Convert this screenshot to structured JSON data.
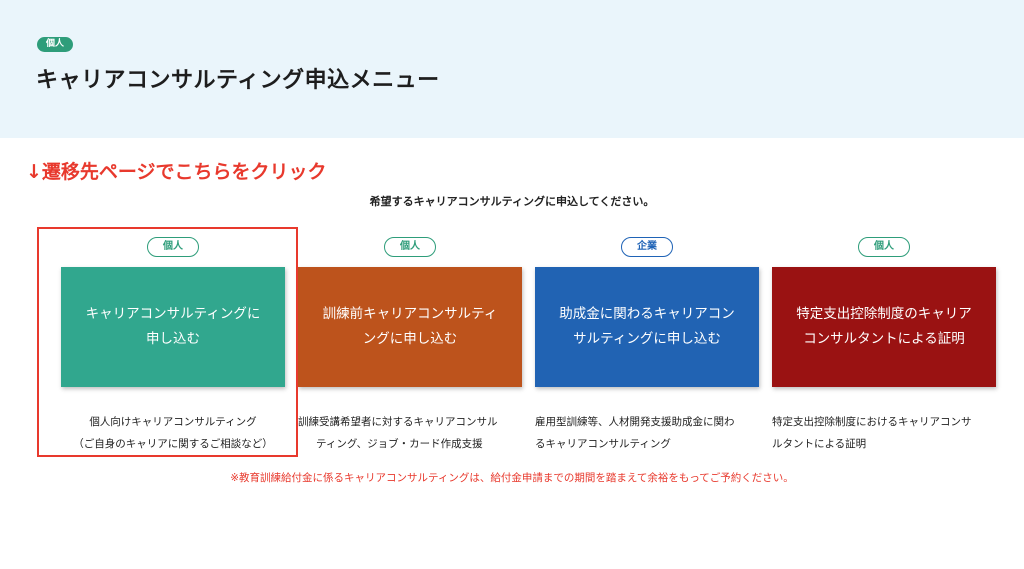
{
  "header": {
    "badge": "個人",
    "title": "キャリアコンサルティング申込メニュー"
  },
  "annotation": "↓遷移先ページでこちらをクリック",
  "instruction": "希望するキャリアコンサルティングに申込してください。",
  "cards": [
    {
      "badge": "個人",
      "tile_line1": "キャリアコンサルティングに",
      "tile_line2": "申し込む",
      "desc_line1": "個人向けキャリアコンサルティング",
      "desc_line2": "（ご自身のキャリアに関するご相談など）"
    },
    {
      "badge": "個人",
      "tile_line1": "訓練前キャリアコンサルティ",
      "tile_line2": "ングに申し込む",
      "desc_line1": "訓練受講希望者に対するキャリアコンサル",
      "desc_line2": "ティング、ジョブ・カード作成支援"
    },
    {
      "badge": "企業",
      "tile_line1": "助成金に関わるキャリアコン",
      "tile_line2": "サルティングに申し込む",
      "desc_line1": "雇用型訓練等、人材開発支援助成金に関わ",
      "desc_line2": "るキャリアコンサルティング"
    },
    {
      "badge": "個人",
      "tile_line1": "特定支出控除制度のキャリア",
      "tile_line2": "コンサルタントによる証明",
      "desc_line1": "特定支出控除制度におけるキャリアコンサ",
      "desc_line2": "ルタントによる証明"
    }
  ],
  "note": "※教育訓練給付金に係るキャリアコンサルティングは、給付金申請までの期間を踏まえて余裕をもってご予約ください。",
  "colors": {
    "header_bg": "#eaf5fb",
    "accent_green": "#2e9d7a",
    "accent_blue": "#1f63b6",
    "tile_green": "#31a78e",
    "tile_orange": "#bd531c",
    "tile_blue": "#2163b3",
    "tile_red": "#9a1212",
    "annotation_red": "#e8392d"
  }
}
